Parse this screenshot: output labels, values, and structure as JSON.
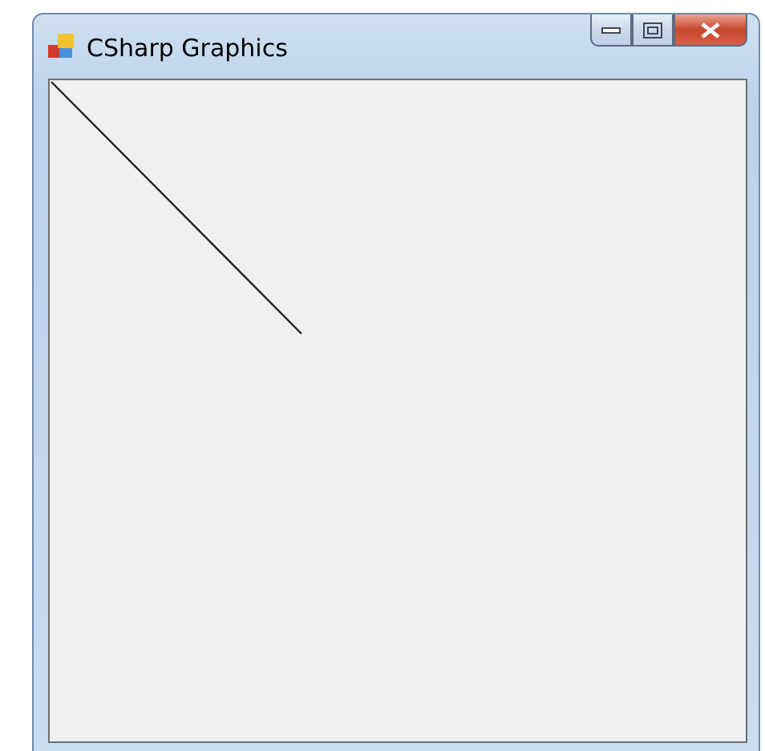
{
  "window": {
    "title": "CSharp Graphics"
  }
}
